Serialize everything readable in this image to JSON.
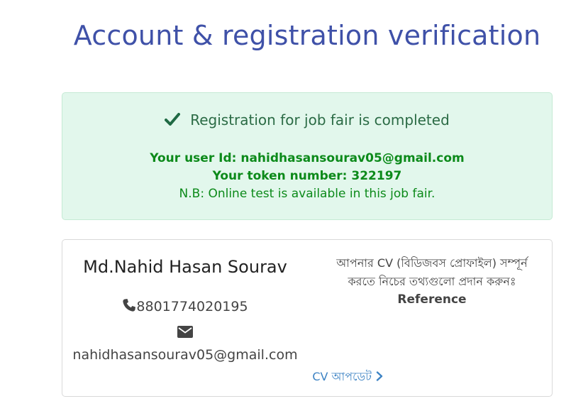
{
  "page": {
    "title": "Account & registration verification"
  },
  "success": {
    "heading": "Registration for job fair is completed",
    "user_id_label": "Your user Id:",
    "user_id": "nahidhasansourav05@gmail.com",
    "token_label": "Your token number:",
    "token": "322197",
    "note": "N.B: Online test is available in this job fair."
  },
  "profile": {
    "name": "Md.Nahid Hasan Sourav",
    "phone": "8801774020195",
    "email": "nahidhasansourav05@gmail.com",
    "cv_update_label": "CV আপডেট",
    "cv_prompt": "আপনার CV (বিডিজবস প্রোফাইল) সম্পূর্ন করতে নিচের তথ্যগুলো প্রদান করুনঃ",
    "reference_label": "Reference"
  },
  "icons": {
    "check": "check-icon",
    "phone": "phone-icon",
    "mail": "mail-icon",
    "chevron": "chevron-right-icon"
  },
  "colors": {
    "title": "#3f51a8",
    "success_bg": "#e2f7ec",
    "success_text": "#2b6b45",
    "info_text": "#0c8a1a",
    "link": "#3d83c4"
  }
}
